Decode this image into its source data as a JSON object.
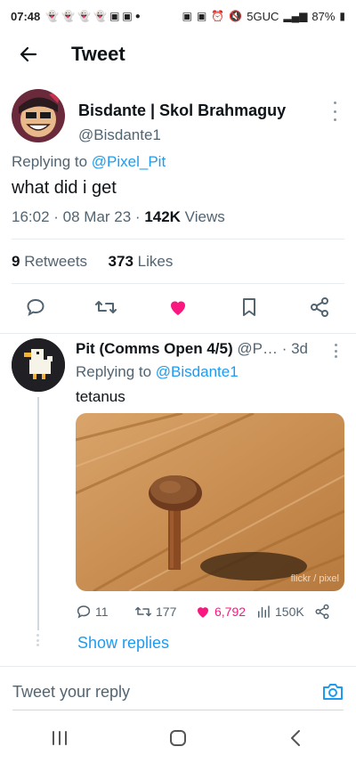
{
  "status_bar": {
    "time": "07:48",
    "network": "5GUC",
    "battery": "87%",
    "icons": [
      "snapchat-icon",
      "snapchat-icon",
      "snapchat-icon",
      "snapchat-icon",
      "notification-icon",
      "notification-icon",
      "dot-icon"
    ]
  },
  "header": {
    "title": "Tweet",
    "back_icon": "arrow-left-icon"
  },
  "tweet": {
    "author_name": "Bisdante | Skol Brahmaguy",
    "author_handle": "@Bisdante1",
    "replying_prefix": "Replying to ",
    "replying_handle": "@Pixel_Pit",
    "text": "what did i get",
    "timestamp": "16:02 · 08 Mar 23 · ",
    "views_count": "142K",
    "views_label": " Views",
    "retweets_count": "9",
    "retweets_label": " Retweets",
    "likes_count": "373",
    "likes_label": " Likes"
  },
  "reply": {
    "author_name": "Pit (Comms Open 4/5)",
    "author_handle": " @P…",
    "age": " · 3d",
    "replying_prefix": "Replying to ",
    "replying_handle": "@Bisdante1",
    "text": "tetanus",
    "watermark": "flickr / pixel",
    "actions": {
      "replies": "11",
      "retweets": "177",
      "likes": "6,792",
      "views": "150K"
    },
    "show_replies": "Show replies"
  },
  "composer": {
    "placeholder": "Tweet your reply"
  },
  "colors": {
    "accent": "#1d9bf0",
    "like": "#f91880",
    "secondary": "#536471"
  }
}
